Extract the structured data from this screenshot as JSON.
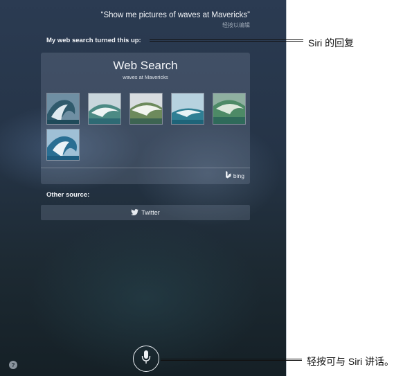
{
  "siri": {
    "utterance": "“Show me pictures of waves at Mavericks”",
    "edit_hint": "轻按以编辑",
    "response_label": "My web search turned this up:",
    "web_search": {
      "title": "Web Search",
      "query": "waves at Mavericks",
      "thumbnails": [
        "wave-image-1",
        "wave-image-2",
        "wave-image-3",
        "wave-image-4",
        "wave-image-5",
        "wave-image-6"
      ],
      "provider": "bing"
    },
    "other_source_label": "Other source:",
    "twitter_label": "Twitter"
  },
  "annotations": {
    "response_callout": "Siri 的回复",
    "mic_callout": "轻按可与 Siri 讲话。"
  },
  "colors": {
    "accent_text": "#f2f4f7",
    "card_bg": "rgba(150,165,185,0.22)"
  }
}
